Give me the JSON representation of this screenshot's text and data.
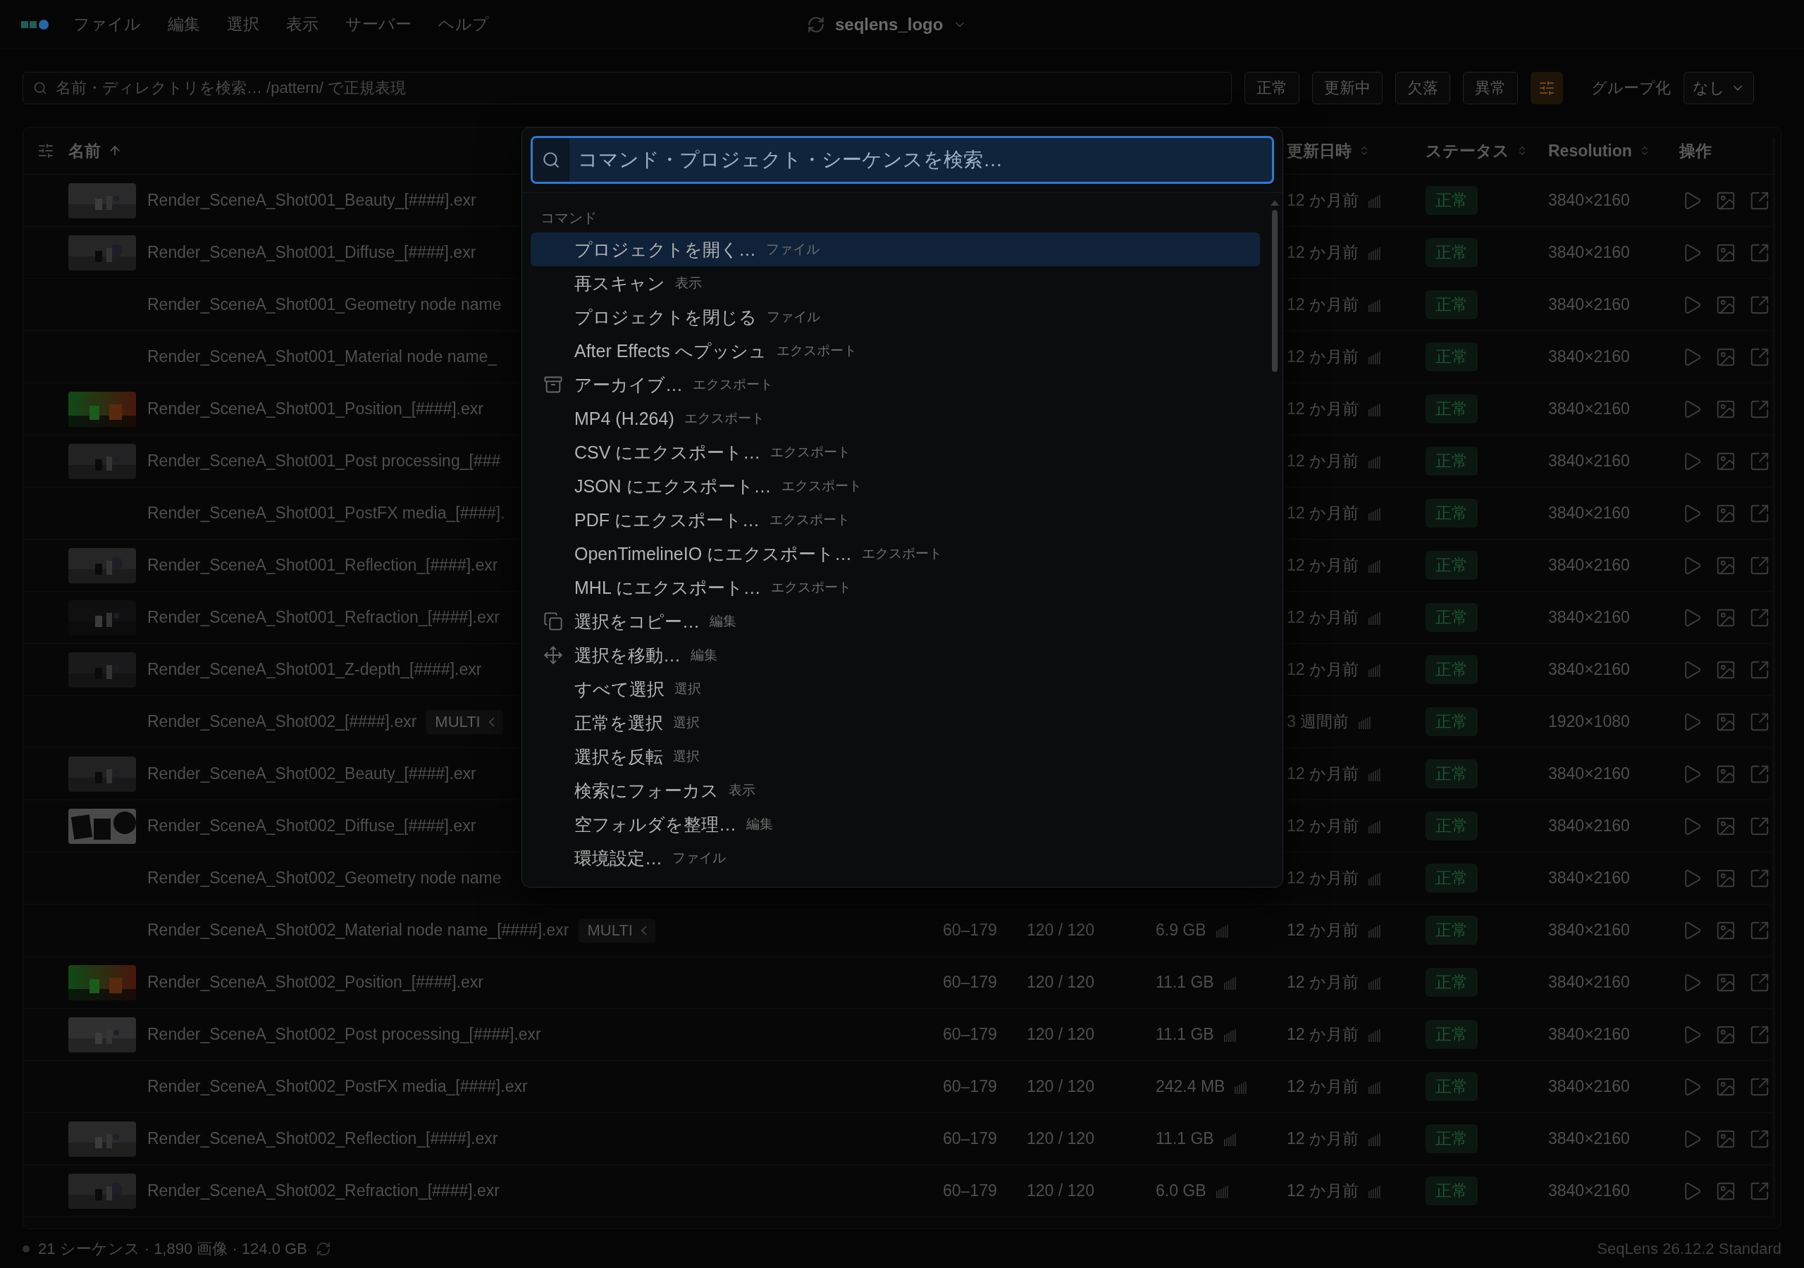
{
  "menubar": {
    "menus": [
      "ファイル",
      "編集",
      "選択",
      "表示",
      "サーバー",
      "ヘルプ"
    ],
    "project": "seqlens_logo"
  },
  "toolbar": {
    "search": {
      "placeholder": "名前・ディレクトリを検索… /pattern/ で正規表現"
    },
    "filters": [
      {
        "label": "正常"
      },
      {
        "label": "更新中"
      },
      {
        "label": "欠落"
      },
      {
        "label": "異常"
      }
    ],
    "group_label": "グループ化",
    "group_value": "なし"
  },
  "table": {
    "columns": [
      {
        "kind": "name",
        "label": "名前",
        "sorted": true
      },
      {
        "kind": "updated",
        "label": "更新日時",
        "sorted": false
      },
      {
        "kind": "status",
        "label": "ステータス",
        "sorted": false
      },
      {
        "kind": "resolution",
        "label": "Resolution",
        "sorted": false
      },
      {
        "kind": "actions",
        "label": "操作"
      }
    ],
    "rows": [
      {
        "kind": "picture",
        "name": "Render_SceneA_Shot001_Beauty_[####].exr",
        "updated": "12 か月前",
        "status": {
          "label": "正常",
          "kind": "ok"
        },
        "resolution": "3840×2160"
      },
      {
        "kind": "picture",
        "name": "Render_SceneA_Shot001_Diffuse_[####].exr",
        "updated": "12 か月前",
        "status": {
          "label": "正常",
          "kind": "ok"
        },
        "resolution": "3840×2160"
      },
      {
        "kind": "plain",
        "name": "Render_SceneA_Shot001_Geometry node name",
        "updated": "12 か月前",
        "status": {
          "label": "正常",
          "kind": "ok"
        },
        "resolution": "3840×2160"
      },
      {
        "kind": "plain",
        "name": "Render_SceneA_Shot001_Material node name_",
        "updated": "12 か月前",
        "status": {
          "label": "正常",
          "kind": "ok"
        },
        "resolution": "3840×2160"
      },
      {
        "kind": "picture",
        "name": "Render_SceneA_Shot001_Position_[####].exr",
        "updated": "12 か月前",
        "status": {
          "label": "正常",
          "kind": "ok"
        },
        "resolution": "3840×2160"
      },
      {
        "kind": "picture",
        "name": "Render_SceneA_Shot001_Post processing_[###",
        "updated": "12 か月前",
        "status": {
          "label": "正常",
          "kind": "ok"
        },
        "resolution": "3840×2160"
      },
      {
        "kind": "plain",
        "name": "Render_SceneA_Shot001_PostFX media_[####].",
        "updated": "12 か月前",
        "status": {
          "label": "正常",
          "kind": "ok"
        },
        "resolution": "3840×2160"
      },
      {
        "kind": "picture",
        "name": "Render_SceneA_Shot001_Reflection_[####].exr",
        "updated": "12 か月前",
        "status": {
          "label": "正常",
          "kind": "ok"
        },
        "resolution": "3840×2160"
      },
      {
        "kind": "picture",
        "name": "Render_SceneA_Shot001_Refraction_[####].exr",
        "updated": "12 か月前",
        "status": {
          "label": "正常",
          "kind": "ok"
        },
        "resolution": "3840×2160"
      },
      {
        "kind": "picture",
        "name": "Render_SceneA_Shot001_Z-depth_[####].exr",
        "updated": "12 か月前",
        "status": {
          "label": "正常",
          "kind": "ok"
        },
        "resolution": "3840×2160"
      },
      {
        "kind": "plain",
        "name": "Render_SceneA_Shot002_[####].exr",
        "badge": "MULTI",
        "updated": "3 週間前",
        "status": {
          "label": "正常",
          "kind": "ok"
        },
        "resolution": "1920×1080"
      },
      {
        "kind": "picture",
        "name": "Render_SceneA_Shot002_Beauty_[####].exr",
        "updated": "12 か月前",
        "status": {
          "label": "正常",
          "kind": "ok"
        },
        "resolution": "3840×2160"
      },
      {
        "kind": "picture",
        "name": "Render_SceneA_Shot002_Diffuse_[####].exr",
        "updated": "12 か月前",
        "status": {
          "label": "正常",
          "kind": "ok"
        },
        "resolution": "3840×2160"
      },
      {
        "kind": "plain",
        "name": "Render_SceneA_Shot002_Geometry node name",
        "updated": "12 か月前",
        "status": {
          "label": "正常",
          "kind": "ok"
        },
        "resolution": "3840×2160"
      },
      {
        "kind": "plain",
        "name": "Render_SceneA_Shot002_Material node name_[####].exr",
        "badge": "MULTI",
        "frames": "60–179",
        "count": "120 / 120",
        "size": "6.9 GB",
        "updated": "12 か月前",
        "status": {
          "label": "正常",
          "kind": "ok"
        },
        "resolution": "3840×2160"
      },
      {
        "kind": "picture",
        "name": "Render_SceneA_Shot002_Position_[####].exr",
        "frames": "60–179",
        "count": "120 / 120",
        "size": "11.1 GB",
        "updated": "12 か月前",
        "status": {
          "label": "正常",
          "kind": "ok"
        },
        "resolution": "3840×2160"
      },
      {
        "kind": "picture",
        "name": "Render_SceneA_Shot002_Post processing_[####].exr",
        "frames": "60–179",
        "count": "120 / 120",
        "size": "11.1 GB",
        "updated": "12 か月前",
        "status": {
          "label": "正常",
          "kind": "ok"
        },
        "resolution": "3840×2160"
      },
      {
        "kind": "plain",
        "name": "Render_SceneA_Shot002_PostFX media_[####].exr",
        "frames": "60–179",
        "count": "120 / 120",
        "size": "242.4 MB",
        "updated": "12 か月前",
        "status": {
          "label": "正常",
          "kind": "ok"
        },
        "resolution": "3840×2160"
      },
      {
        "kind": "picture",
        "name": "Render_SceneA_Shot002_Reflection_[####].exr",
        "frames": "60–179",
        "count": "120 / 120",
        "size": "11.1 GB",
        "updated": "12 か月前",
        "status": {
          "label": "正常",
          "kind": "ok"
        },
        "resolution": "3840×2160"
      },
      {
        "kind": "picture",
        "name": "Render_SceneA_Shot002_Refraction_[####].exr",
        "frames": "60–179",
        "count": "120 / 120",
        "size": "6.0 GB",
        "updated": "12 か月前",
        "status": {
          "label": "正常",
          "kind": "ok"
        },
        "resolution": "3840×2160"
      }
    ]
  },
  "status_bar": {
    "summary": "21 シーケンス · 1,890 画像 · 124.0 GB",
    "version": "SeqLens 26.12.2 Standard"
  },
  "command_palette": {
    "search": {
      "placeholder": "コマンド・プロジェクト・シーケンスを検索…"
    },
    "section": "コマンド",
    "items": [
      {
        "label": "プロジェクトを開く…",
        "category": "ファイル",
        "selected": true
      },
      {
        "label": "再スキャン",
        "category": "表示",
        "selected": false
      },
      {
        "label": "プロジェクトを閉じる",
        "category": "ファイル",
        "selected": false
      },
      {
        "label": "After Effects へプッシュ",
        "category": "エクスポート",
        "selected": false
      },
      {
        "label": "アーカイブ…",
        "category": "エクスポート",
        "kind": "archive",
        "selected": false
      },
      {
        "label": "MP4 (H.264)",
        "category": "エクスポート",
        "selected": false
      },
      {
        "label": "CSV にエクスポート…",
        "category": "エクスポート",
        "selected": false
      },
      {
        "label": "JSON にエクスポート…",
        "category": "エクスポート",
        "selected": false
      },
      {
        "label": "PDF にエクスポート…",
        "category": "エクスポート",
        "selected": false
      },
      {
        "label": "OpenTimelineIO にエクスポート…",
        "category": "エクスポート",
        "selected": false
      },
      {
        "label": "MHL にエクスポート…",
        "category": "エクスポート",
        "selected": false
      },
      {
        "label": "選択をコピー…",
        "category": "編集",
        "kind": "copy",
        "selected": false
      },
      {
        "label": "選択を移動…",
        "category": "編集",
        "kind": "move",
        "selected": false
      },
      {
        "label": "すべて選択",
        "category": "選択",
        "selected": false
      },
      {
        "label": "正常を選択",
        "category": "選択",
        "selected": false
      },
      {
        "label": "選択を反転",
        "category": "選択",
        "selected": false
      },
      {
        "label": "検索にフォーカス",
        "category": "表示",
        "selected": false
      },
      {
        "label": "空フォルダを整理…",
        "category": "編集",
        "selected": false
      },
      {
        "label": "環境設定…",
        "category": "ファイル",
        "selected": false
      }
    ]
  }
}
